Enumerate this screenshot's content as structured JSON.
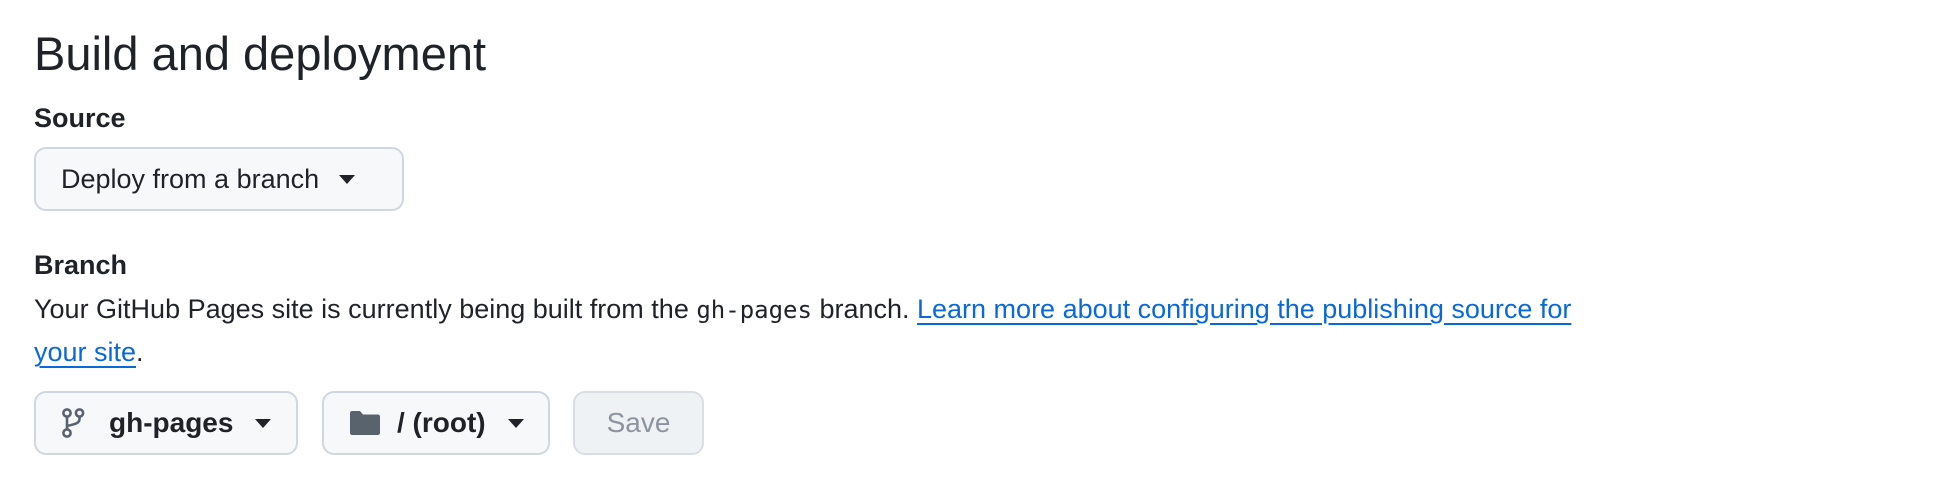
{
  "section": {
    "title": "Build and deployment"
  },
  "source": {
    "label": "Source",
    "selected": "Deploy from a branch"
  },
  "branch": {
    "label": "Branch",
    "description_prefix": "Your GitHub Pages site is currently being built from the ",
    "branch_code": "gh-pages",
    "description_suffix": " branch. ",
    "learn_more_link": "Learn more about configuring the publishing source for your site",
    "trailing": ".",
    "branch_select": "gh-pages",
    "folder_select": "/ (root)",
    "save_label": "Save"
  },
  "colors": {
    "link": "#0969da",
    "text": "#1f2328",
    "button_bg": "#f6f8fa",
    "button_border": "#d0d7de",
    "disabled_text": "#8c959f"
  },
  "icons": {
    "source_caret": "triangle-down-icon",
    "branch": "git-branch-icon",
    "folder": "file-directory-icon",
    "branch_caret": "triangle-down-icon",
    "folder_caret": "triangle-down-icon"
  }
}
